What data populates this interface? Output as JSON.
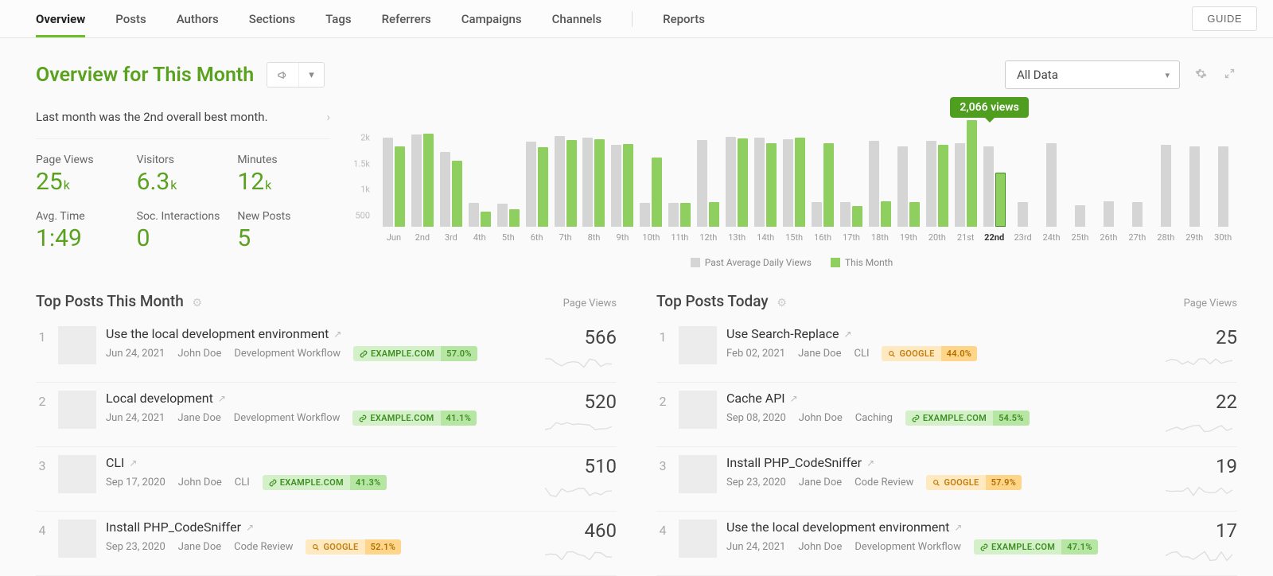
{
  "tabs": [
    "Overview",
    "Posts",
    "Authors",
    "Sections",
    "Tags",
    "Referrers",
    "Campaigns",
    "Channels",
    "Reports"
  ],
  "active_tab": 0,
  "guide_label": "GUIDE",
  "page_title": "Overview for This Month",
  "data_filter": "All Data",
  "insight_text": "Last month was the 2nd overall best month.",
  "metrics": [
    {
      "label": "Page Views",
      "value": "25",
      "unit": "k"
    },
    {
      "label": "Visitors",
      "value": "6.3",
      "unit": "k"
    },
    {
      "label": "Minutes",
      "value": "12",
      "unit": "k"
    },
    {
      "label": "Avg. Time",
      "value": "1:49",
      "unit": ""
    },
    {
      "label": "Soc. Interactions",
      "value": "0",
      "unit": ""
    },
    {
      "label": "New Posts",
      "value": "5",
      "unit": ""
    }
  ],
  "chart_data": {
    "type": "bar",
    "ylabel": "",
    "ylim": [
      0,
      2000
    ],
    "y_ticks": [
      "2k",
      "1.5k",
      "1k",
      "500"
    ],
    "categories": [
      "Jun",
      "2nd",
      "3rd",
      "4th",
      "5th",
      "6th",
      "7th",
      "8th",
      "9th",
      "10th",
      "11th",
      "12th",
      "13th",
      "14th",
      "15th",
      "16th",
      "17th",
      "18th",
      "19th",
      "20th",
      "21st",
      "22nd",
      "23rd",
      "24th",
      "25th",
      "26th",
      "27th",
      "28th",
      "29th",
      "30th"
    ],
    "tooltip": {
      "index": 20,
      "text": "2,066 views"
    },
    "highlight_index": 21,
    "series": [
      {
        "name": "Past Average Daily Views",
        "color": "#d5d5d5",
        "values": [
          1730,
          1780,
          1450,
          460,
          440,
          1640,
          1750,
          1720,
          1580,
          460,
          460,
          1680,
          1740,
          1720,
          1700,
          480,
          480,
          1660,
          1560,
          1660,
          1620,
          1550,
          470,
          1620,
          420,
          500,
          480,
          1580,
          1560,
          1560
        ]
      },
      {
        "name": "This Month",
        "color": "#8fcf5f",
        "values": [
          1560,
          1800,
          1280,
          300,
          340,
          1540,
          1680,
          1700,
          1600,
          1340,
          460,
          480,
          1710,
          1620,
          1720,
          1620,
          400,
          500,
          480,
          1580,
          2066,
          1050,
          null,
          null,
          null,
          null,
          null,
          null,
          null,
          null
        ]
      }
    ],
    "legend": [
      {
        "label": "Past Average Daily Views",
        "color": "#d5d5d5"
      },
      {
        "label": "This Month",
        "color": "#8fcf5f"
      }
    ]
  },
  "tables": [
    {
      "title": "Top Posts This Month",
      "metric_label": "Page Views",
      "rows": [
        {
          "rank": "1",
          "title": "Use the local development environment",
          "date": "Jun 24, 2021",
          "author": "John Doe",
          "section": "Development Workflow",
          "ref": {
            "kind": "green",
            "source": "EXAMPLE.COM",
            "pct": "57.0%",
            "icon": "link"
          },
          "value": "566"
        },
        {
          "rank": "2",
          "title": "Local development",
          "date": "Jun 24, 2021",
          "author": "Jane Doe",
          "section": "Development Workflow",
          "ref": {
            "kind": "green",
            "source": "EXAMPLE.COM",
            "pct": "41.1%",
            "icon": "link"
          },
          "value": "520"
        },
        {
          "rank": "3",
          "title": "CLI",
          "date": "Sep 17, 2020",
          "author": "John Doe",
          "section": "CLI",
          "ref": {
            "kind": "green",
            "source": "EXAMPLE.COM",
            "pct": "41.3%",
            "icon": "link"
          },
          "value": "510"
        },
        {
          "rank": "4",
          "title": "Install PHP_CodeSniffer",
          "date": "Sep 23, 2020",
          "author": "Jane Doe",
          "section": "Code Review",
          "ref": {
            "kind": "orange",
            "source": "GOOGLE",
            "pct": "52.1%",
            "icon": "search"
          },
          "value": "460"
        }
      ]
    },
    {
      "title": "Top Posts Today",
      "metric_label": "Page Views",
      "rows": [
        {
          "rank": "1",
          "title": "Use Search-Replace",
          "date": "Feb 02, 2021",
          "author": "Jane Doe",
          "section": "CLI",
          "ref": {
            "kind": "orange",
            "source": "GOOGLE",
            "pct": "44.0%",
            "icon": "search"
          },
          "value": "25"
        },
        {
          "rank": "2",
          "title": "Cache API",
          "date": "Sep 08, 2020",
          "author": "John Doe",
          "section": "Caching",
          "ref": {
            "kind": "green",
            "source": "EXAMPLE.COM",
            "pct": "54.5%",
            "icon": "link"
          },
          "value": "22"
        },
        {
          "rank": "3",
          "title": "Install PHP_CodeSniffer",
          "date": "Sep 23, 2020",
          "author": "Jane Doe",
          "section": "Code Review",
          "ref": {
            "kind": "orange",
            "source": "GOOGLE",
            "pct": "57.9%",
            "icon": "search"
          },
          "value": "19"
        },
        {
          "rank": "4",
          "title": "Use the local development environment",
          "date": "Jun 24, 2021",
          "author": "John Doe",
          "section": "Development Workflow",
          "ref": {
            "kind": "green",
            "source": "EXAMPLE.COM",
            "pct": "47.1%",
            "icon": "link"
          },
          "value": "17"
        }
      ]
    }
  ]
}
